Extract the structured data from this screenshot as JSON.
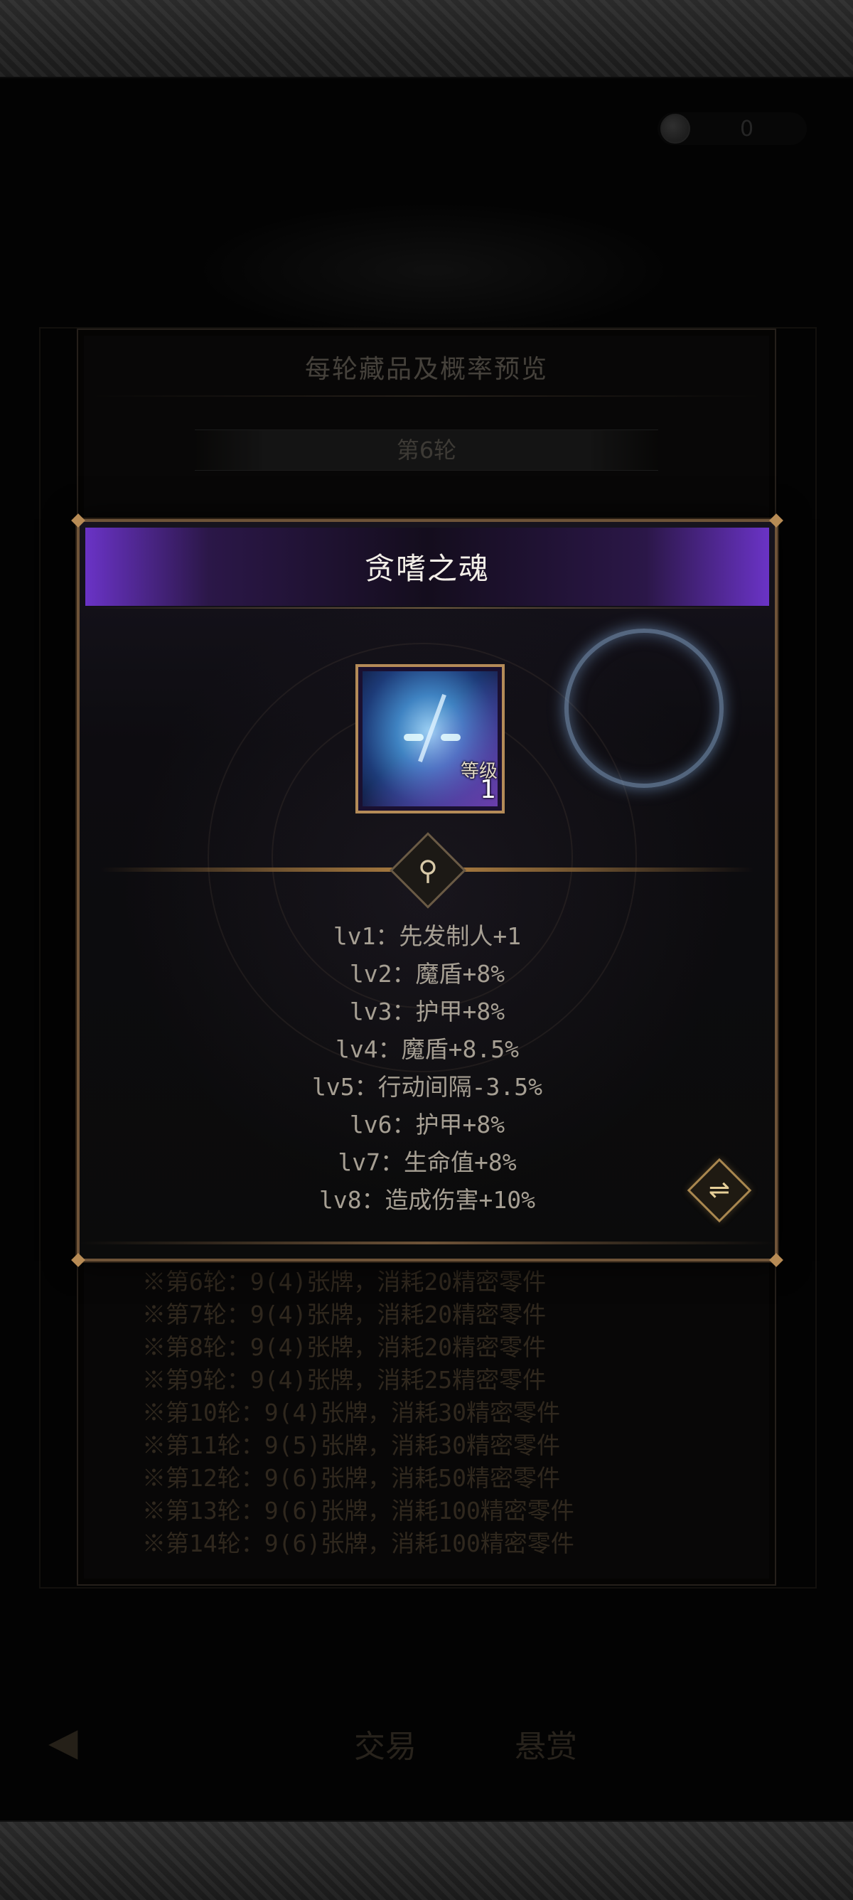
{
  "currency": {
    "value": "0",
    "icon": "coin-icon"
  },
  "back_panel": {
    "title": "每轮藏品及概率预览",
    "round_selector": "第6轮",
    "rounds": [
      "※第6轮：9(4)张牌，消耗20精密零件",
      "※第7轮：9(4)张牌，消耗20精密零件",
      "※第8轮：9(4)张牌，消耗20精密零件",
      "※第9轮：9(4)张牌，消耗25精密零件",
      "※第10轮：9(4)张牌，消耗30精密零件",
      "※第11轮：9(5)张牌，消耗30精密零件",
      "※第12轮：9(6)张牌，消耗50精密零件",
      "※第13轮：9(6)张牌，消耗100精密零件",
      "※第14轮：9(6)张牌，消耗100精密零件"
    ]
  },
  "nav": {
    "back": "◀",
    "trade": "交易",
    "bounty": "悬赏"
  },
  "popup": {
    "title": "贪嗜之魂",
    "item": {
      "level_label": "等级",
      "level_value": "1",
      "icon": "soul-portrait"
    },
    "stats": [
      "lv1：先发制人+1",
      "lv2：魔盾+8%",
      "lv3：护甲+8%",
      "lv4：魔盾+8.5%",
      "lv5：行动间隔-3.5%",
      "lv6：护甲+8%",
      "lv7：生命值+8%",
      "lv8：造成伤害+10%"
    ],
    "magnifier": "⚲",
    "toggle": "⇌"
  },
  "colors": {
    "rarity_purple": "#6a33c6",
    "frame_gold": "#b48b58"
  }
}
